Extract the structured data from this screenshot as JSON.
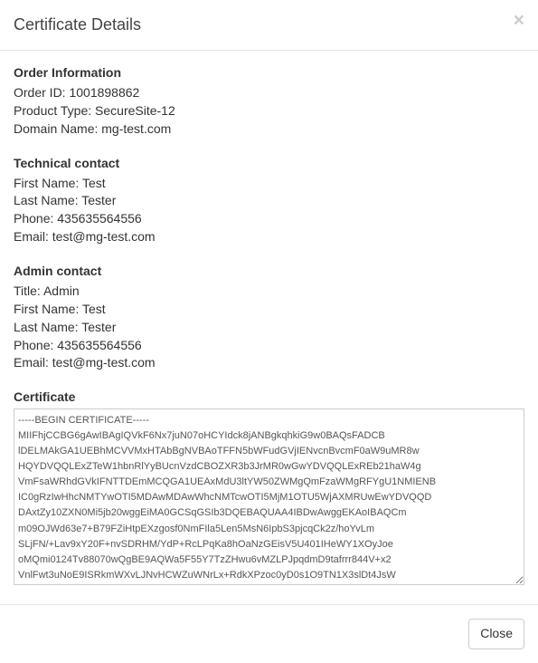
{
  "header": {
    "title": "Certificate Details",
    "close_symbol": "×"
  },
  "sections": {
    "order_info": {
      "title": "Order Information",
      "order_id": {
        "label": "Order ID:",
        "value": "1001898862"
      },
      "product_type": {
        "label": "Product Type:",
        "value": "SecureSite-12"
      },
      "domain_name": {
        "label": "Domain Name:",
        "value": "mg-test.com"
      }
    },
    "tech_contact": {
      "title": "Technical contact",
      "first_name": {
        "label": "First Name:",
        "value": "Test"
      },
      "last_name": {
        "label": "Last Name:",
        "value": "Tester"
      },
      "phone": {
        "label": "Phone:",
        "value": "435635564556"
      },
      "email": {
        "label": "Email:",
        "value": "test@mg-test.com"
      }
    },
    "admin_contact": {
      "title": "Admin contact",
      "title_field": {
        "label": "Title:",
        "value": "Admin"
      },
      "first_name": {
        "label": "First Name:",
        "value": "Test"
      },
      "last_name": {
        "label": "Last Name:",
        "value": "Tester"
      },
      "phone": {
        "label": "Phone:",
        "value": "435635564556"
      },
      "email": {
        "label": "Email:",
        "value": "test@mg-test.com"
      }
    },
    "certificate": {
      "title": "Certificate",
      "body": "-----BEGIN CERTIFICATE-----\nMIIFhjCCBG6gAwIBAgIQVkF6Nx7juN07oHCYIdck8jANBgkqhkiG9w0BAQsFADCB\nlDELMAkGA1UEBhMCVVMxHTAbBgNVBAoTFFN5bWFudGVjIENvcnBvcmF0aW9uMR8w\nHQYDVQQLExZTeW1hbnRlYyBUcnVzdCBOZXR3b3JrMR0wGwYDVQQLExREb21haW4g\nVmFsaWRhdGVkIFNTTDEmMCQGA1UEAxMdU3ltYW50ZWMgQmFzaWMgRFYgU1NMIENB\nIC0gRzIwHhcNMTYwOTI5MDAwMDAwWhcNMTcwOTI5MjM1OTU5WjAXMRUwEwYDVQQD\nDAxtZy10ZXN0Mi5jb20wggEiMA0GCSqGSIb3DQEBAQUAA4IBDwAwggEKAoIBAQCm\nm09OJWd63e7+B79FZiHtpEXzgosf0NmFIla5Len5MsN6IpbS3pjcqCk2z/hoYvLm\nSLjFN/+Lav9xY20F+nvSDRHM/YdP+RcLPqKa8hOaNzGEisV5U401IHeWY1XOyJoe\noMQmi0124Tv88070wQgBE9AQWa5F55Y7TzZHwu6vMZLPJpqdmD9tafrrr844V+x2\nVnlFwt3uNoE9ISRkmWXvLJNvHCWZuWNrLx+RdkXPzoc0yD0s1O9TN1X3slDt4JsW\n"
    }
  },
  "footer": {
    "close_label": "Close"
  }
}
